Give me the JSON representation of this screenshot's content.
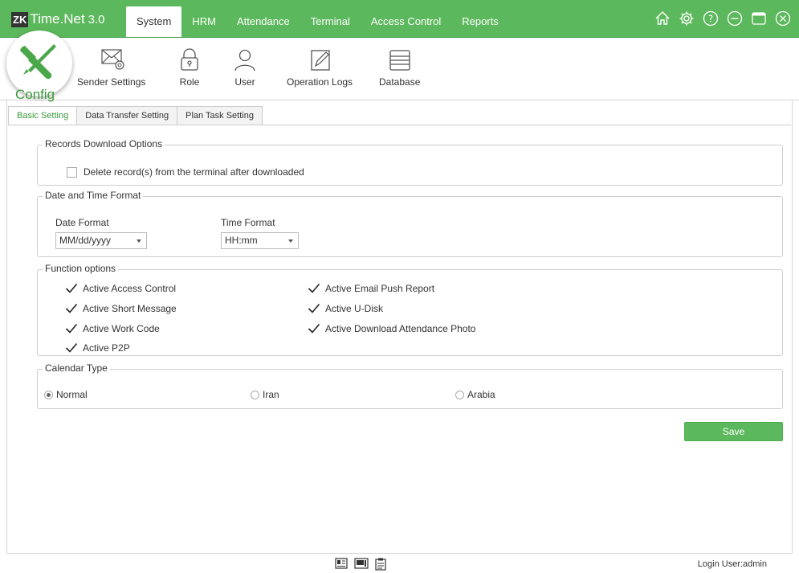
{
  "app": {
    "logo_badge": "ZK",
    "logo_name": "Time.Net",
    "logo_version": "3.0"
  },
  "menu": [
    {
      "label": "System",
      "active": true
    },
    {
      "label": "HRM"
    },
    {
      "label": "Attendance"
    },
    {
      "label": "Terminal"
    },
    {
      "label": "Access Control"
    },
    {
      "label": "Reports"
    }
  ],
  "window_icons": [
    "home-icon",
    "settings-icon",
    "help-icon",
    "minimize-icon",
    "maximize-icon",
    "close-icon"
  ],
  "toolbar": {
    "config": "Config",
    "sender_settings": "Sender Settings",
    "role": "Role",
    "user": "User",
    "operation_logs": "Operation Logs",
    "database": "Database"
  },
  "subtabs": [
    "Basic Setting",
    "Data Transfer Setting",
    "Plan Task Setting"
  ],
  "records": {
    "title": "Records Download Options",
    "delete_after_download": {
      "label": "Delete record(s) from the terminal after downloaded",
      "checked": false
    }
  },
  "datetime": {
    "title": "Date and Time Format",
    "date_label": "Date Format",
    "date_value": "MM/dd/yyyy",
    "time_label": "Time Format",
    "time_value": "HH:mm"
  },
  "functions": {
    "title": "Function options",
    "items": [
      {
        "label": "Active Access Control",
        "checked": true
      },
      {
        "label": "Active Short Message",
        "checked": true
      },
      {
        "label": "Active Work Code",
        "checked": true
      },
      {
        "label": "Active P2P",
        "checked": true
      },
      {
        "label": "Active Email Push Report",
        "checked": true
      },
      {
        "label": "Active U-Disk",
        "checked": true
      },
      {
        "label": "Active Download Attendance Photo",
        "checked": true
      }
    ]
  },
  "calendar": {
    "title": "Calendar Type",
    "options": [
      {
        "label": "Normal",
        "selected": true
      },
      {
        "label": "Iran",
        "selected": false
      },
      {
        "label": "Arabia",
        "selected": false
      }
    ]
  },
  "save_label": "Save",
  "status": {
    "login_user": "Login User:admin"
  },
  "colors": {
    "accent": "#5cb85c",
    "accent_dark": "#3c9a3c"
  }
}
